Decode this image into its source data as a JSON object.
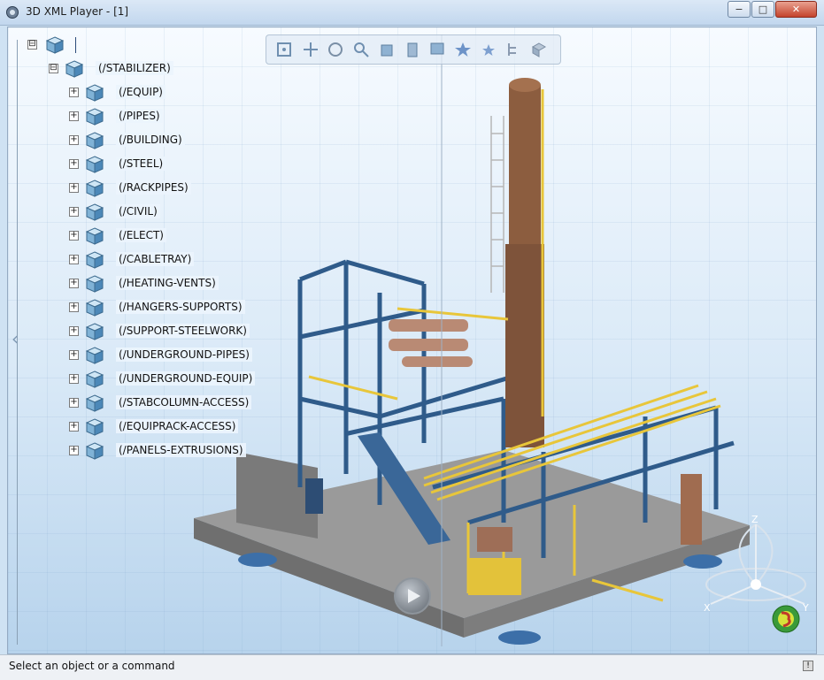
{
  "window": {
    "title": "3D XML Player - [1]",
    "controls": {
      "minimize": "−",
      "maximize": "□",
      "close": "✕"
    }
  },
  "tree": {
    "root_expander": "⊟",
    "stabilizer": {
      "label": "(/STABILIZER)",
      "expander": "⊟"
    },
    "children": [
      {
        "label": "(/EQUIP)"
      },
      {
        "label": "(/PIPES)"
      },
      {
        "label": "(/BUILDING)"
      },
      {
        "label": "(/STEEL)"
      },
      {
        "label": "(/RACKPIPES)"
      },
      {
        "label": "(/CIVIL)"
      },
      {
        "label": "(/ELECT)"
      },
      {
        "label": "(/CABLETRAY)"
      },
      {
        "label": "(/HEATING-VENTS)"
      },
      {
        "label": "(/HANGERS-SUPPORTS)"
      },
      {
        "label": "(/SUPPORT-STEELWORK)"
      },
      {
        "label": "(/UNDERGROUND-PIPES)"
      },
      {
        "label": "(/UNDERGROUND-EQUIP)"
      },
      {
        "label": "(/STABCOLUMN-ACCESS)"
      },
      {
        "label": "(/EQUIPRACK-ACCESS)"
      },
      {
        "label": "(/PANELS-EXTRUSIONS)"
      }
    ]
  },
  "toolbar": {
    "icons": [
      "fit-all-icon",
      "pan-icon",
      "rotate-icon",
      "zoom-icon",
      "view-cube-icon",
      "render-style-icon",
      "hide-show-icon",
      "star-icon",
      "star-small-icon",
      "tree-icon",
      "box-icon"
    ]
  },
  "compass": {
    "x": "X",
    "y": "Y",
    "z": "Z"
  },
  "status": {
    "text": "Select an object or a command"
  },
  "colors": {
    "accent": "#2e5f9a",
    "steel": "#2f5b8a",
    "column": "#8a5a3c",
    "pipes": "#e8c63a",
    "deck": "#8c8c8c"
  }
}
